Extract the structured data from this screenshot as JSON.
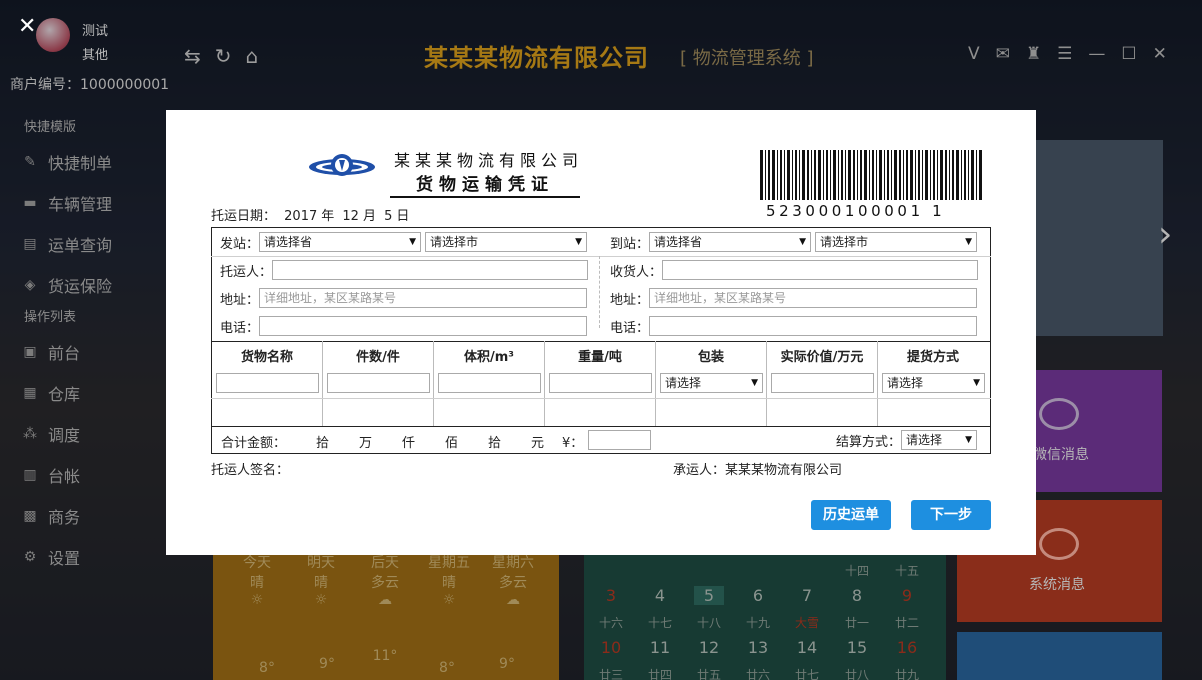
{
  "app": {
    "user_name": "测试",
    "user_role": "其他",
    "account_label": "商户编号：1000000001",
    "company_title": "某某某物流有限公司",
    "system_title": "[ 物流管理系统 ]"
  },
  "sidebar": {
    "section_quick": "快捷模版",
    "items_quick": [
      {
        "label": "快捷制单",
        "icon": "edit-icon"
      },
      {
        "label": "车辆管理",
        "icon": "truck-icon"
      },
      {
        "label": "运单查询",
        "icon": "list-icon"
      },
      {
        "label": "货运保险",
        "icon": "shield-icon"
      }
    ],
    "section_ops": "操作列表",
    "items_ops": [
      {
        "label": "前台",
        "icon": "monitor-icon"
      },
      {
        "label": "仓库",
        "icon": "warehouse-icon"
      },
      {
        "label": "调度",
        "icon": "dispatch-icon"
      },
      {
        "label": "台帐",
        "icon": "ledger-icon"
      },
      {
        "label": "商务",
        "icon": "briefcase-icon"
      },
      {
        "label": "设置",
        "icon": "gear-icon"
      }
    ]
  },
  "tiles": {
    "wechat_label": "微信消息",
    "system_label": "系统消息"
  },
  "weather": {
    "days": [
      {
        "day": "今天",
        "cond": "晴",
        "temp": "8°"
      },
      {
        "day": "明天",
        "cond": "晴",
        "temp": "9°"
      },
      {
        "day": "后天",
        "cond": "多云",
        "temp": "11°"
      },
      {
        "day": "星期五",
        "cond": "晴",
        "temp": "8°"
      },
      {
        "day": "星期六",
        "cond": "多云",
        "temp": "9°"
      }
    ]
  },
  "calendar": {
    "row1_lunar": [
      "十四",
      "十五"
    ],
    "row2": [
      "3",
      "4",
      "5",
      "6",
      "7",
      "8",
      "9"
    ],
    "row2_lunar": [
      "十六",
      "十七",
      "十八",
      "十九",
      "大雪",
      "廿一",
      "廿二"
    ],
    "row3": [
      "10",
      "11",
      "12",
      "13",
      "14",
      "15",
      "16"
    ],
    "row3_lunar": [
      "廿三",
      "廿四",
      "廿五",
      "廿六",
      "廿七",
      "廿八",
      "廿九"
    ]
  },
  "form": {
    "company": "某某某物流有限公司",
    "title": "货物运输凭证",
    "date_label": "托运日期：",
    "date_year": "2017",
    "date_year_unit": "年",
    "date_month": "12",
    "date_month_unit": "月",
    "date_day": "5",
    "date_day_unit": "日",
    "barcode_number": "523000100001 1",
    "from_station_label": "发站：",
    "to_station_label": "到站：",
    "province_placeholder": "请选择省",
    "city_placeholder": "请选择市",
    "shipper_label": "托运人：",
    "consignee_label": "收货人：",
    "address_label": "地址：",
    "address_placeholder": "详细地址，某区某路某号",
    "phone_label": "电话：",
    "columns": [
      "货物名称",
      "件数/件",
      "体积/m³",
      "重量/吨",
      "包装",
      "实际价值/万元",
      "提货方式"
    ],
    "select_placeholder": "请选择",
    "total_label": "合计金额：",
    "units": [
      "拾",
      "万",
      "仟",
      "佰",
      "拾",
      "元"
    ],
    "currency": "¥：",
    "settle_label": "结算方式：",
    "shipper_sign_label": "托运人签名：",
    "carrier_label": "承运人：某某某物流有限公司",
    "history_button": "历史运单",
    "next_button": "下一步"
  }
}
